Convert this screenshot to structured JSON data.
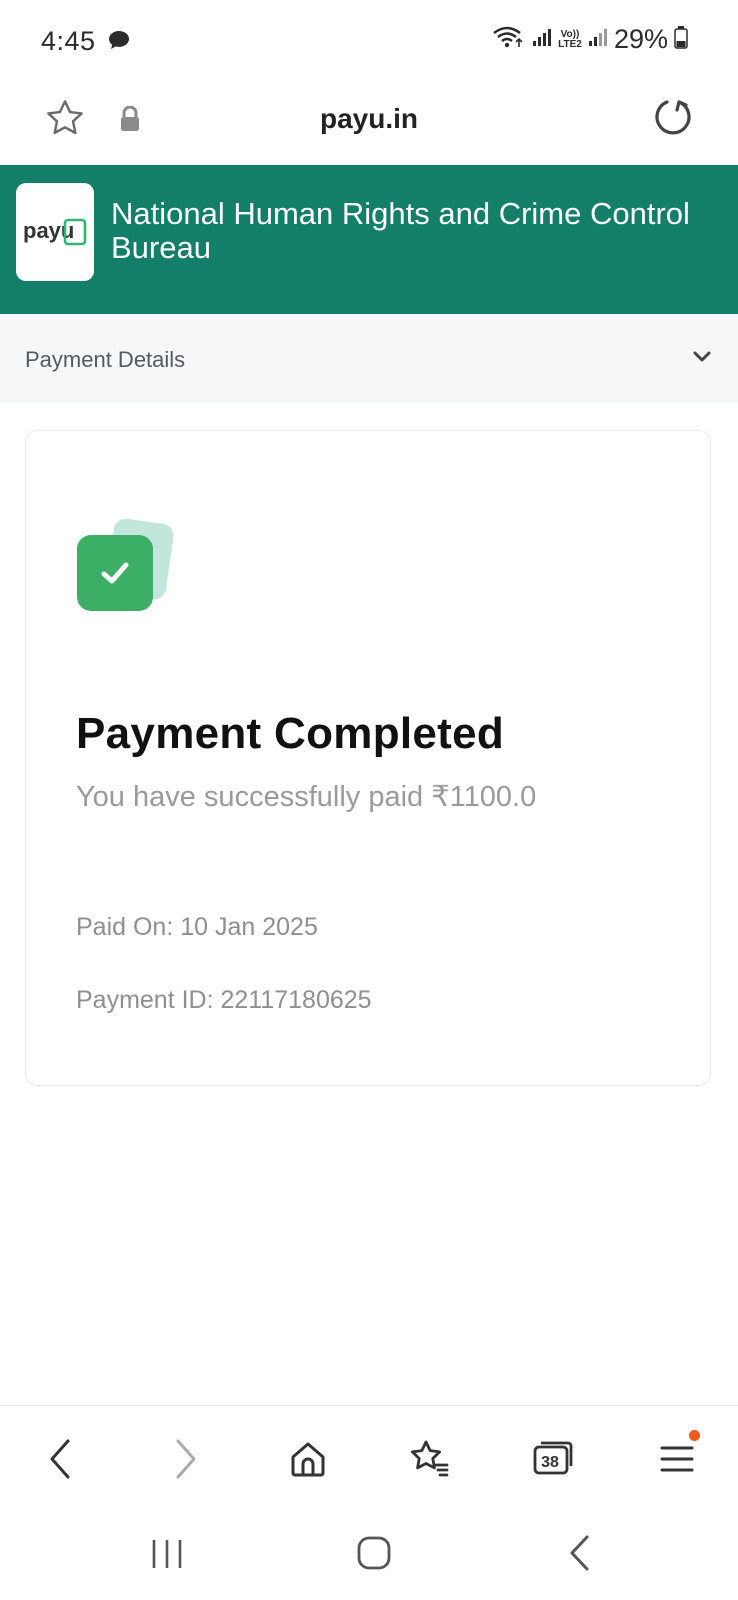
{
  "status_bar": {
    "time": "4:45",
    "network_label": "Vo)) LTE2",
    "battery": "29%",
    "icons": [
      "chat-icon",
      "wifi-icon",
      "signal-icon",
      "signal-icon",
      "battery-icon"
    ]
  },
  "browser": {
    "url": "payu.in",
    "icons": [
      "star-icon",
      "lock-icon",
      "reload-icon"
    ]
  },
  "merchant": {
    "logo_text": "payu",
    "name": "National Human Rights and Crime Control Bureau",
    "brand_color": "#137f69"
  },
  "payment_details": {
    "label": "Payment Details"
  },
  "result": {
    "title": "Payment Completed",
    "subtitle": "You have successfully paid ₹1100.0",
    "paid_on": "Paid On: 10 Jan 2025",
    "payment_id": "Payment ID: 22117180625",
    "status_color": "#3dae65"
  },
  "bottom_nav": {
    "tab_count": "38",
    "icons": [
      "back-icon",
      "forward-icon",
      "home-icon",
      "bookmarks-icon",
      "tabs-icon",
      "menu-icon"
    ]
  },
  "system_nav": {
    "icons": [
      "recent-apps-icon",
      "home-button-icon",
      "back-button-icon"
    ]
  }
}
